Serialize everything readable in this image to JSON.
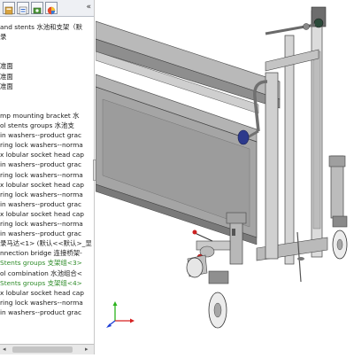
{
  "feature_tree": {
    "items": [
      {
        "label": "and stents 水池和支架（默",
        "selected": false
      },
      {
        "label": "录",
        "selected": false
      },
      {
        "label": "",
        "selected": false
      },
      {
        "label": "",
        "selected": false
      },
      {
        "label": "准面",
        "selected": false
      },
      {
        "label": "准面",
        "selected": false
      },
      {
        "label": "准面",
        "selected": false
      },
      {
        "label": "",
        "selected": false
      },
      {
        "label": "",
        "selected": false
      },
      {
        "label": "mp mounting bracket 水",
        "selected": false
      },
      {
        "label": "ol stents groups 水池支",
        "selected": false
      },
      {
        "label": "in washers--product grac",
        "selected": false
      },
      {
        "label": "ring lock washers--norma",
        "selected": false
      },
      {
        "label": "x lobular socket head cap",
        "selected": false
      },
      {
        "label": "in washers--product grac",
        "selected": false
      },
      {
        "label": "ring lock washers--norma",
        "selected": false
      },
      {
        "label": "x lobular socket head cap",
        "selected": false
      },
      {
        "label": "ring lock washers--norma",
        "selected": false
      },
      {
        "label": "in washers--product grac",
        "selected": false
      },
      {
        "label": "x lobular socket head cap",
        "selected": false
      },
      {
        "label": "ring lock washers--norma",
        "selected": false
      },
      {
        "label": "in washers--product grac",
        "selected": false
      },
      {
        "label": "录马达<1> (默认<<默认>_显",
        "selected": false
      },
      {
        "label": "nnection bridge 连接桥架-",
        "selected": false
      },
      {
        "label": "Stents groups 支架组<3>",
        "selected": true
      },
      {
        "label": "ol combination 水池组合<",
        "selected": false
      },
      {
        "label": "Stents groups 支架组<4>",
        "selected": true
      },
      {
        "label": "x lobular socket head cap",
        "selected": false
      },
      {
        "label": "ring lock washers--norma",
        "selected": false
      },
      {
        "label": "in washers--product grac",
        "selected": false
      }
    ],
    "collapse_glyph": "«",
    "accent_selected": "#2f8c2a",
    "tabs": [
      {
        "icon": "feature-manager-icon"
      },
      {
        "icon": "property-manager-icon"
      },
      {
        "icon": "configuration-manager-icon"
      },
      {
        "icon": "appearance-icon"
      }
    ]
  },
  "viewport": {
    "model": "pool-stand-assembly",
    "colors": {
      "steel": "#a7a7a7",
      "dark_steel": "#6c6c6c",
      "handle": "#2d3a8c",
      "valve": "#cc2222",
      "wheel": "#e9e9e9"
    },
    "triad": {
      "x_label": "",
      "y_label": "",
      "z_label": ""
    }
  }
}
